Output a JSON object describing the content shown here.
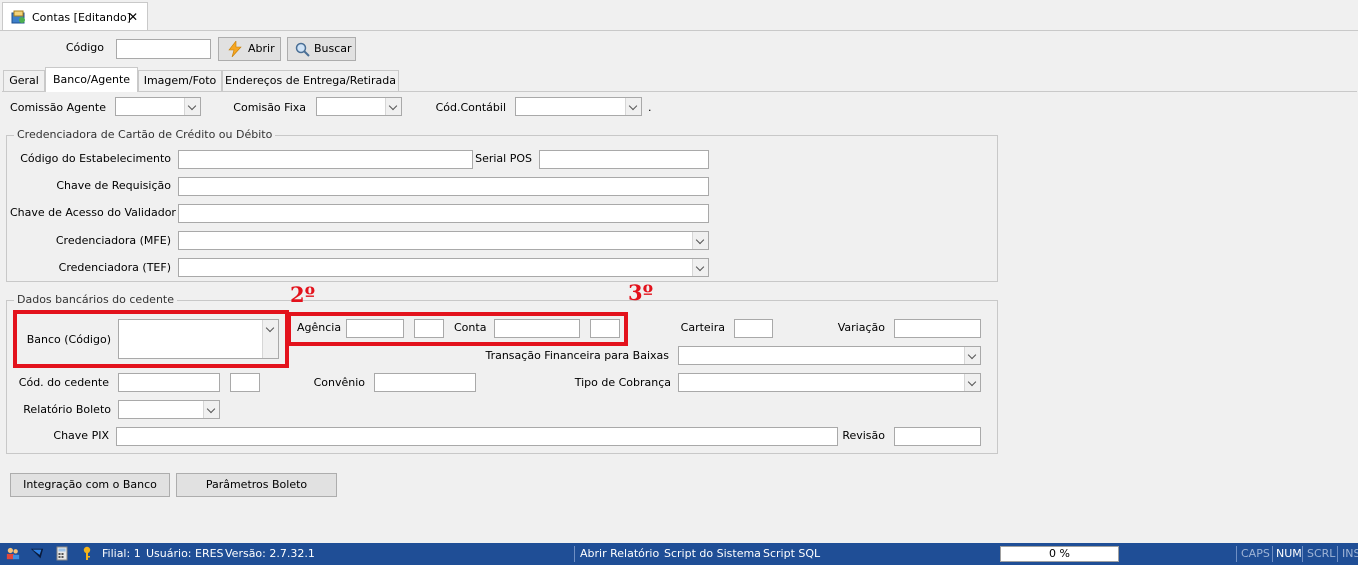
{
  "window": {
    "doc_tab_title": "Contas [Editando]",
    "close_glyph": "✕"
  },
  "toolbar": {
    "codigo_label": "Código",
    "codigo_value": "",
    "abrir_label": "Abrir",
    "buscar_label": "Buscar"
  },
  "tabs": [
    {
      "label": "Geral"
    },
    {
      "label": "Banco/Agente"
    },
    {
      "label": "Imagem/Foto"
    },
    {
      "label": "Endereços de Entrega/Retirada"
    }
  ],
  "agent": {
    "comissao_agente_label": "Comissão Agente",
    "comissao_fixa_label": "Comisão Fixa",
    "cod_contabil_label": "Cód.Contábil",
    "cod_contabil_suffix": "."
  },
  "credenciadora": {
    "group_title": "Credenciadora de Cartão de Crédito ou Débito",
    "codigo_estabelecimento_label": "Código do Estabelecimento",
    "serial_pos_label": "Serial POS",
    "chave_requisicao_label": "Chave de Requisição",
    "chave_acesso_label": "Chave de Acesso do Validador",
    "credenciadora_mfe_label": "Credenciadora (MFE)",
    "credenciadora_tef_label": "Credenciadora (TEF)"
  },
  "bancarios": {
    "group_title": "Dados bancários do cedente",
    "banco_label": "Banco (Código)",
    "agencia_label": "Agência",
    "conta_label": "Conta",
    "carteira_label": "Carteira",
    "variacao_label": "Variação",
    "transacao_label": "Transação Financeira para Baixas",
    "cod_cedente_label": "Cód. do cedente",
    "convenio_label": "Convênio",
    "tipo_cobranca_label": "Tipo de Cobrança",
    "relatorio_boleto_label": "Relatório Boleto",
    "chave_pix_label": "Chave PIX",
    "revisao_label": "Revisão"
  },
  "annotations": {
    "second": "2º",
    "third": "3º"
  },
  "actions": {
    "integracao_label": "Integração com o Banco",
    "parametros_label": "Parâmetros Boleto"
  },
  "statusbar": {
    "filial": "Filial: 1",
    "usuario": "Usuário: ERES",
    "versao": "Versão: 2.7.32.1",
    "abrir_relatorio": "Abrir Relatório",
    "script_sistema": "Script do Sistema",
    "script_sql": "Script SQL",
    "progress_text": "0 %",
    "progress": 0,
    "caps": "CAPS",
    "num": "NUM",
    "scrl": "SCRL",
    "ins": "INS"
  },
  "colors": {
    "accent_red": "#e3121c",
    "status_bar": "#1f4e96"
  }
}
